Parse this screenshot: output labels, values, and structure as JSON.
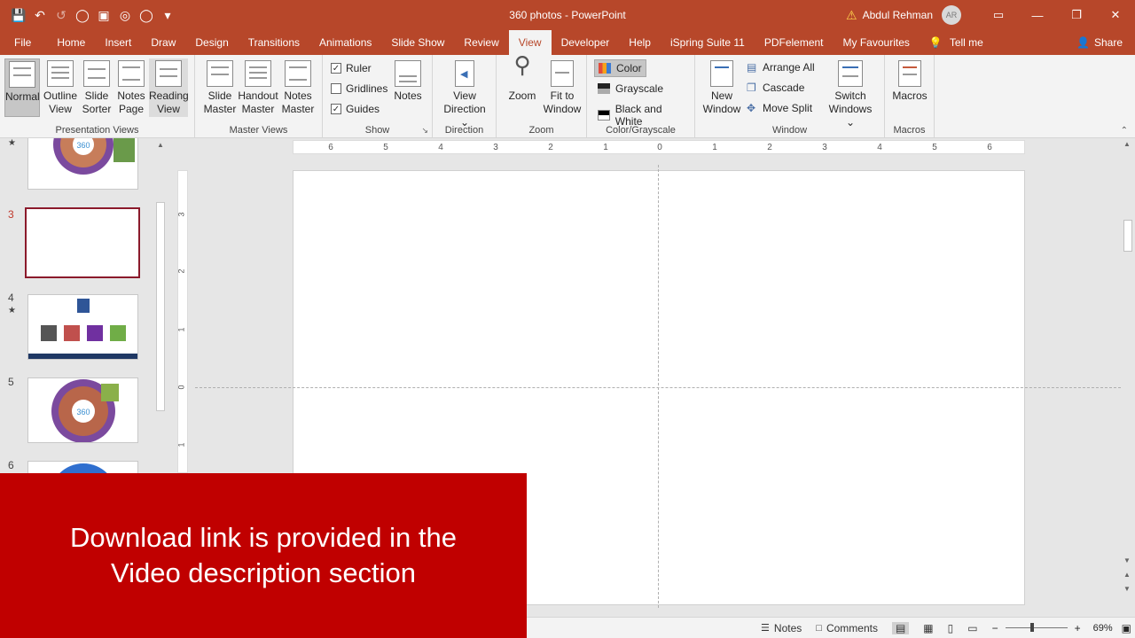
{
  "window": {
    "title": "360 photos  -  PowerPoint",
    "user_name": "Abdul Rehman",
    "user_initials": "AR"
  },
  "tabs": [
    "File",
    "Home",
    "Insert",
    "Draw",
    "Design",
    "Transitions",
    "Animations",
    "Slide Show",
    "Review",
    "View",
    "Developer",
    "Help",
    "iSpring Suite 11",
    "PDFelement",
    "My Favourites"
  ],
  "tell_me": "Tell me",
  "share": "Share",
  "ribbon": {
    "presentation_views": {
      "label": "Presentation Views",
      "normal": "Normal",
      "outline_view": [
        "Outline",
        "View"
      ],
      "slide_sorter": [
        "Slide",
        "Sorter"
      ],
      "notes_page": [
        "Notes",
        "Page"
      ],
      "reading_view": [
        "Reading",
        "View"
      ]
    },
    "master_views": {
      "label": "Master Views",
      "slide_master": [
        "Slide",
        "Master"
      ],
      "handout_master": [
        "Handout",
        "Master"
      ],
      "notes_master": [
        "Notes",
        "Master"
      ]
    },
    "show": {
      "label": "Show",
      "ruler": "Ruler",
      "gridlines": "Gridlines",
      "guides": "Guides",
      "notes": "Notes",
      "ruler_checked": true,
      "gridlines_checked": false,
      "guides_checked": true
    },
    "direction": {
      "label": "Direction",
      "view_direction": [
        "View",
        "Direction ⌄"
      ]
    },
    "zoom": {
      "label": "Zoom",
      "zoom": "Zoom",
      "fit_to_window": [
        "Fit to",
        "Window"
      ]
    },
    "color_grayscale": {
      "label": "Color/Grayscale",
      "color": "Color",
      "grayscale": "Grayscale",
      "black_and_white": "Black and White"
    },
    "window": {
      "label": "Window",
      "new_window": [
        "New",
        "Window"
      ],
      "arrange_all": "Arrange All",
      "cascade": "Cascade",
      "move_split": "Move Split",
      "switch_windows": [
        "Switch",
        "Windows ⌄"
      ]
    },
    "macros": {
      "label": "Macros",
      "macros": "Macros"
    }
  },
  "slides_panel": {
    "numbers": [
      "3",
      "4",
      "5",
      "6"
    ]
  },
  "ruler": {
    "h_ticks": [
      "6",
      "5",
      "4",
      "3",
      "2",
      "1",
      "0",
      "1",
      "2",
      "3",
      "4",
      "5",
      "6"
    ],
    "v_ticks": [
      "3",
      "2",
      "1",
      "0",
      "1"
    ]
  },
  "statusbar": {
    "notes": "Notes",
    "comments": "Comments",
    "zoom_level": "69%"
  },
  "banner": {
    "line1": "Download link is provided in the",
    "line2": "Video description section"
  },
  "colors": {
    "accent": "#b7472a",
    "banner": "#c00000",
    "selected_slide_border": "#8b1a2b"
  }
}
